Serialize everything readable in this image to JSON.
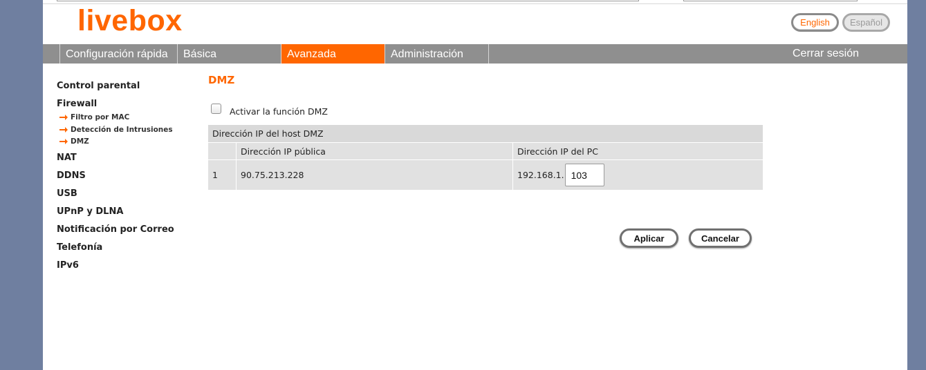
{
  "header": {
    "logo": "livebox",
    "lang_english": "English",
    "lang_spanish": "Español"
  },
  "nav": {
    "tabs": [
      {
        "label": "Configuración rápida"
      },
      {
        "label": "Básica"
      },
      {
        "label": "Avanzada"
      },
      {
        "label": "Administración"
      }
    ],
    "active_tab": "Avanzada",
    "logout": "Cerrar sesión"
  },
  "sidebar": {
    "items": [
      {
        "label": "Control parental"
      },
      {
        "label": "Firewall"
      },
      {
        "label": "NAT"
      },
      {
        "label": "DDNS"
      },
      {
        "label": "USB"
      },
      {
        "label": "UPnP y DLNA"
      },
      {
        "label": "Notificación por Correo"
      },
      {
        "label": "Telefonía"
      },
      {
        "label": "IPv6"
      }
    ],
    "firewall_sub": [
      {
        "label": "Filtro por MAC"
      },
      {
        "label": "Detección de Intrusiones"
      },
      {
        "label": "DMZ"
      }
    ]
  },
  "main": {
    "title": "DMZ",
    "checkbox_label": "Activar la función DMZ",
    "checkbox_checked": false,
    "table": {
      "header": "Dirección IP del host DMZ",
      "columns": [
        "",
        "Dirección IP pública",
        "Dirección IP del PC"
      ],
      "row": {
        "index": "1",
        "public_ip": "90.75.213.228",
        "pc_ip_prefix": "192.168.1.",
        "pc_ip_last": "103"
      }
    },
    "apply_label": "Aplicar",
    "cancel_label": "Cancelar"
  },
  "colors": {
    "accent": "#ff6600",
    "nav_bg": "#8f8f8f",
    "outer_bg": "#6f7fa0"
  },
  "icons": {
    "sub_item_bullet": "orange-arrow-icon"
  }
}
